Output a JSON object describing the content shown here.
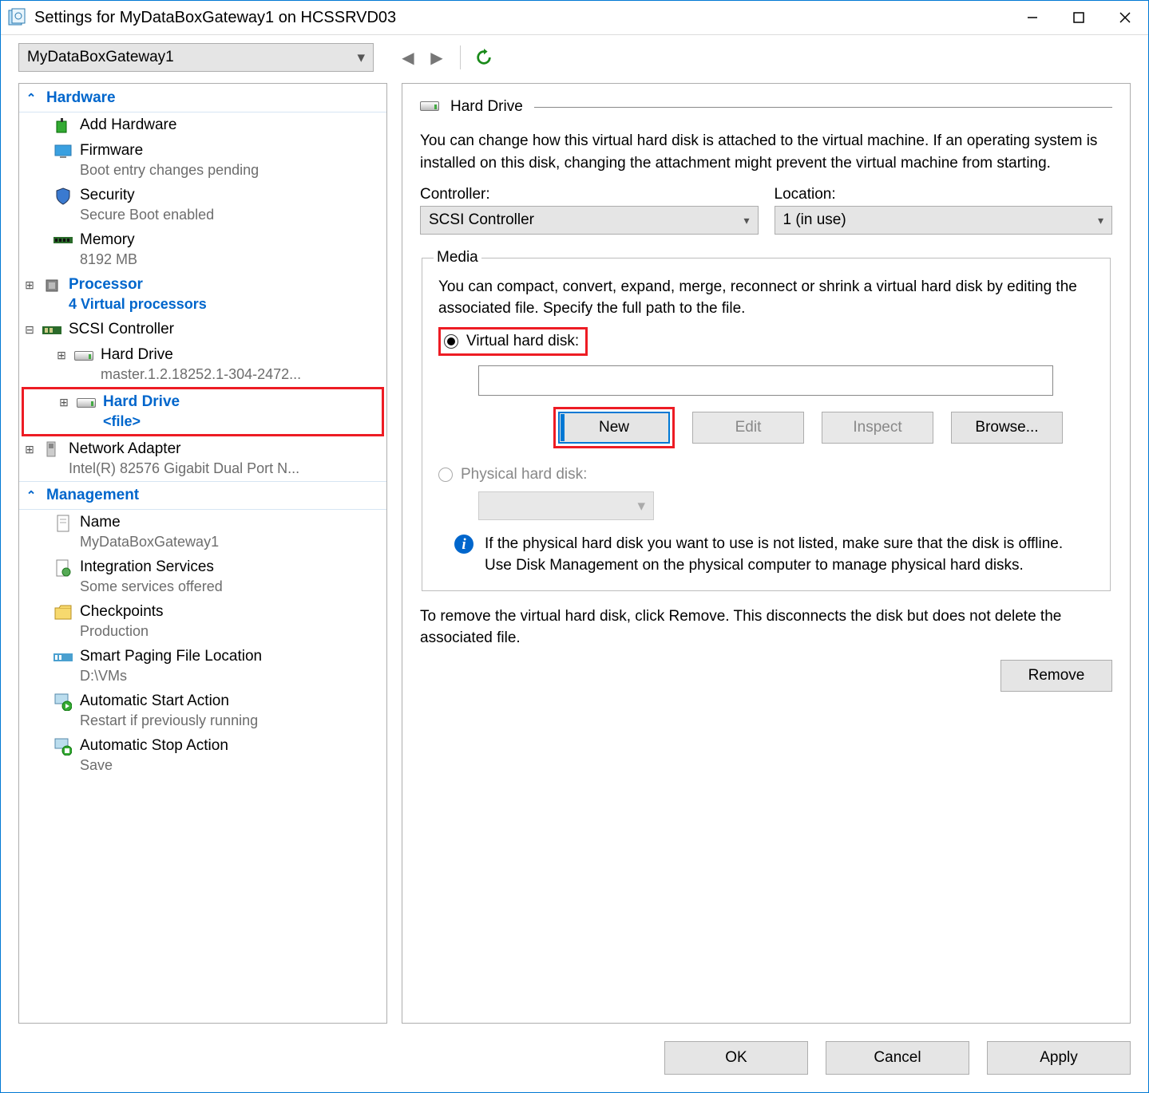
{
  "window": {
    "title": "Settings for MyDataBoxGateway1 on HCSSRVD03"
  },
  "toolbar": {
    "vm_name": "MyDataBoxGateway1"
  },
  "sections": {
    "hardware": "Hardware",
    "management": "Management"
  },
  "tree": {
    "add_hardware": "Add Hardware",
    "firmware": {
      "label": "Firmware",
      "sub": "Boot entry changes pending"
    },
    "security": {
      "label": "Security",
      "sub": "Secure Boot enabled"
    },
    "memory": {
      "label": "Memory",
      "sub": "8192 MB"
    },
    "processor": {
      "label": "Processor",
      "sub": "4 Virtual processors"
    },
    "scsi": {
      "label": "SCSI Controller"
    },
    "hd1": {
      "label": "Hard Drive",
      "sub": "master.1.2.18252.1-304-2472..."
    },
    "hd2": {
      "label": "Hard Drive",
      "sub": "<file>"
    },
    "nic": {
      "label": "Network Adapter",
      "sub": "Intel(R) 82576 Gigabit Dual Port N..."
    },
    "name": {
      "label": "Name",
      "sub": "MyDataBoxGateway1"
    },
    "integ": {
      "label": "Integration Services",
      "sub": "Some services offered"
    },
    "chk": {
      "label": "Checkpoints",
      "sub": "Production"
    },
    "paging": {
      "label": "Smart Paging File Location",
      "sub": "D:\\VMs"
    },
    "astart": {
      "label": "Automatic Start Action",
      "sub": "Restart if previously running"
    },
    "astop": {
      "label": "Automatic Stop Action",
      "sub": "Save"
    }
  },
  "detail": {
    "title": "Hard Drive",
    "description": "You can change how this virtual hard disk is attached to the virtual machine. If an operating system is installed on this disk, changing the attachment might prevent the virtual machine from starting.",
    "controller_label": "Controller:",
    "controller_value": "SCSI Controller",
    "location_label": "Location:",
    "location_value": "1 (in use)",
    "media_legend": "Media",
    "media_desc": "You can compact, convert, expand, merge, reconnect or shrink a virtual hard disk by editing the associated file. Specify the full path to the file.",
    "radio_vhd": "Virtual hard disk:",
    "radio_phys": "Physical hard disk:",
    "btn_new": "New",
    "btn_edit": "Edit",
    "btn_inspect": "Inspect",
    "btn_browse": "Browse...",
    "phys_info": "If the physical hard disk you want to use is not listed, make sure that the disk is offline. Use Disk Management on the physical computer to manage physical hard disks.",
    "remove_note": "To remove the virtual hard disk, click Remove. This disconnects the disk but does not delete the associated file.",
    "btn_remove": "Remove"
  },
  "footer": {
    "ok": "OK",
    "cancel": "Cancel",
    "apply": "Apply"
  }
}
